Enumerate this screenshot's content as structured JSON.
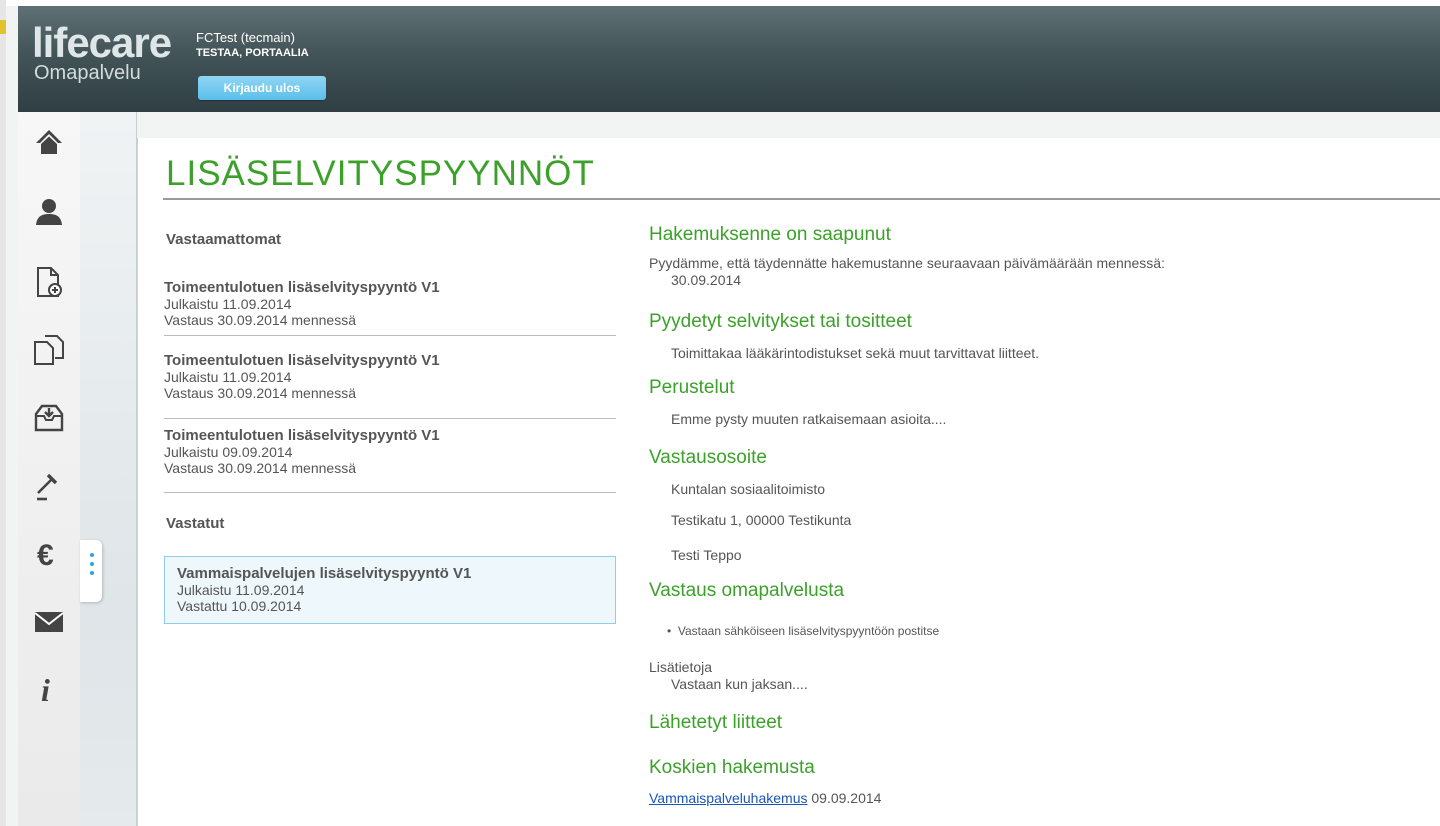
{
  "header": {
    "logo_main": "lifecare",
    "logo_sub": "Omapalvelu",
    "user_line1": "FCTest (tecmain)",
    "user_line2": "TESTAA, PORTAALIA",
    "logout_label": "Kirjaudu ulos"
  },
  "sidebar": {
    "icons": [
      "home-icon",
      "user-icon",
      "new-document-icon",
      "documents-icon",
      "inbox-icon",
      "gavel-icon",
      "euro-icon",
      "mail-icon",
      "info-icon"
    ]
  },
  "page": {
    "title": "LISÄSELVITYSPYYNNÖT"
  },
  "list": {
    "unanswered_heading": "Vastaamattomat",
    "unanswered": [
      {
        "title": "Toimeentulotuen lisäselvityspyyntö V1",
        "published": "Julkaistu 11.09.2014",
        "due": "Vastaus 30.09.2014 mennessä"
      },
      {
        "title": "Toimeentulotuen lisäselvityspyyntö V1",
        "published": "Julkaistu 11.09.2014",
        "due": "Vastaus 30.09.2014 mennessä"
      },
      {
        "title": "Toimeentulotuen lisäselvityspyyntö V1",
        "published": "Julkaistu 09.09.2014",
        "due": "Vastaus 30.09.2014 mennessä"
      }
    ],
    "answered_heading": "Vastatut",
    "answered": [
      {
        "title": "Vammaispalvelujen lisäselvityspyyntö V1",
        "published": "Julkaistu 11.09.2014",
        "due": "Vastattu 10.09.2014"
      }
    ]
  },
  "detail": {
    "received_heading": "Hakemuksenne on saapunut",
    "received_text": "Pyydämme, että täydennätte hakemustanne seuraavaan päivämäärään mennessä:",
    "deadline": "30.09.2014",
    "requested_heading": "Pyydetyt selvitykset tai tositteet",
    "requested_text": "Toimittakaa lääkärintodistukset sekä muut tarvittavat liitteet.",
    "grounds_heading": "Perustelut",
    "grounds_text": "Emme pysty muuten ratkaisemaan asioita....",
    "address_heading": "Vastausosoite",
    "address_lines": [
      "Kuntalan sosiaalitoimisto",
      "Testikatu 1, 00000 Testikunta",
      "Testi Teppo"
    ],
    "reply_heading": "Vastaus omapalvelusta",
    "reply_bullet": "Vastaan sähköiseen lisäselvityspyyntöön postitse",
    "more_info_label": "Lisätietoja",
    "more_info_text": "Vastaan kun jaksan....",
    "attachments_heading": "Lähetetyt liitteet",
    "concerns_heading": "Koskien hakemusta",
    "concerns_link": "Vammaispalveluhakemus",
    "concerns_date": "09.09.2014"
  }
}
